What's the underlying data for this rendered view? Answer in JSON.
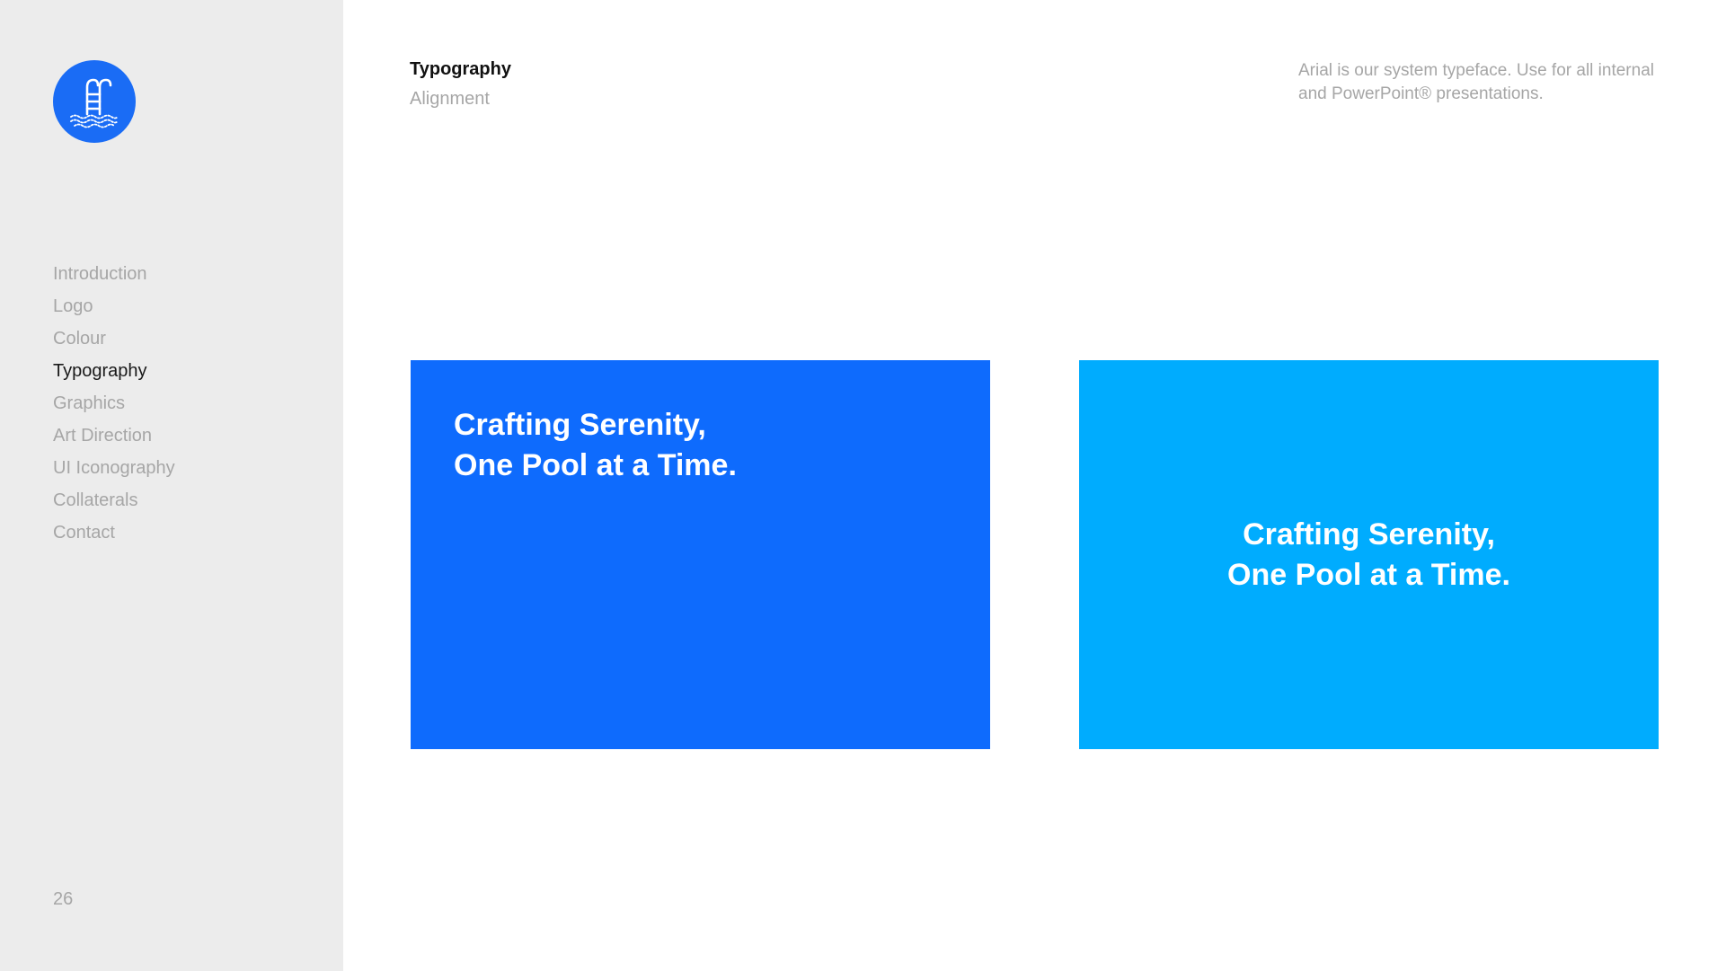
{
  "sidebar": {
    "logo_icon": "pool-ladder-icon",
    "brand_color": "#1a6cf5",
    "nav": [
      {
        "label": "Introduction",
        "active": false
      },
      {
        "label": "Logo",
        "active": false
      },
      {
        "label": "Colour",
        "active": false
      },
      {
        "label": "Typography",
        "active": true
      },
      {
        "label": "Graphics",
        "active": false
      },
      {
        "label": "Art Direction",
        "active": false
      },
      {
        "label": "UI Iconography",
        "active": false
      },
      {
        "label": "Collaterals",
        "active": false
      },
      {
        "label": "Contact",
        "active": false
      }
    ],
    "page_number": "26"
  },
  "header": {
    "title": "Typography",
    "subtitle": "Alignment",
    "description": "Arial is our system typeface. Use for all internal and PowerPoint® presentations."
  },
  "examples": [
    {
      "alignment": "left",
      "background": "#0e6bfd",
      "line1": "Crafting Serenity,",
      "line2": "One Pool at a Time."
    },
    {
      "alignment": "center",
      "background": "#00acfe",
      "line1": "Crafting Serenity,",
      "line2": "One Pool at a Time."
    }
  ]
}
